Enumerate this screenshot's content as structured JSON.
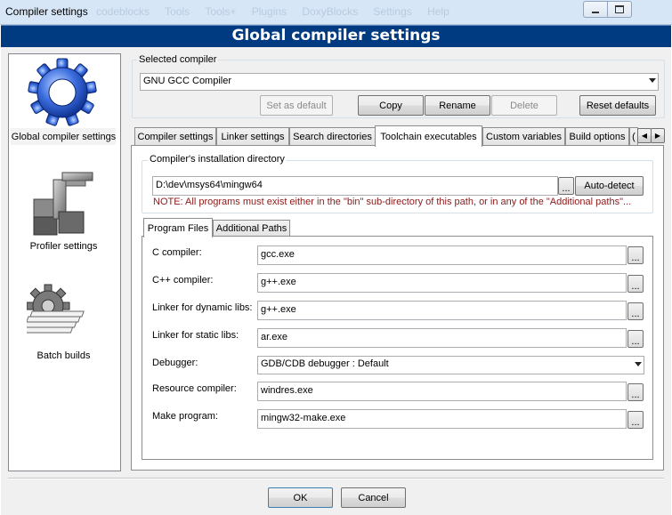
{
  "window": {
    "title": "Compiler settings",
    "ghost_menu": [
      "codeblocks",
      "Tools",
      "Tools+",
      "Plugins",
      "DoxyBlocks",
      "Settings",
      "Help"
    ]
  },
  "header": {
    "title": "Global compiler settings"
  },
  "sidebar": {
    "items": [
      {
        "label": "Global compiler settings",
        "icon": "gear-icon",
        "selected": true
      },
      {
        "label": "Profiler settings",
        "icon": "profiler-icon",
        "selected": false
      },
      {
        "label": "Batch builds",
        "icon": "batch-builds-icon",
        "selected": false
      }
    ]
  },
  "selected_compiler": {
    "group_label": "Selected compiler",
    "value": "GNU GCC Compiler",
    "buttons": {
      "set_default": "Set as default",
      "copy": "Copy",
      "rename": "Rename",
      "delete": "Delete",
      "reset_defaults": "Reset defaults"
    }
  },
  "tabs": [
    {
      "label": "Compiler settings",
      "active": false
    },
    {
      "label": "Linker settings",
      "active": false
    },
    {
      "label": "Search directories",
      "active": false
    },
    {
      "label": "Toolchain executables",
      "active": true
    },
    {
      "label": "Custom variables",
      "active": false
    },
    {
      "label": "Build options",
      "active": false
    },
    {
      "label": "(",
      "active": false
    }
  ],
  "install_dir": {
    "group_label": "Compiler's installation directory",
    "path": "D:\\dev\\msys64\\mingw64",
    "browse": "...",
    "auto_detect": "Auto-detect",
    "note": "NOTE: All programs must exist either in the \"bin\" sub-directory of this path, or in any of the \"Additional paths\"...",
    "note_color": "#8b1a1a"
  },
  "inner_tabs": [
    {
      "label": "Program Files",
      "active": true
    },
    {
      "label": "Additional Paths",
      "active": false
    }
  ],
  "programs": [
    {
      "label": "C compiler:",
      "value": "gcc.exe",
      "type": "text"
    },
    {
      "label": "C++ compiler:",
      "value": "g++.exe",
      "type": "text"
    },
    {
      "label": "Linker for dynamic libs:",
      "value": "g++.exe",
      "type": "text"
    },
    {
      "label": "Linker for static libs:",
      "value": "ar.exe",
      "type": "text"
    },
    {
      "label": "Debugger:",
      "value": "GDB/CDB debugger : Default",
      "type": "select"
    },
    {
      "label": "Resource compiler:",
      "value": "windres.exe",
      "type": "text"
    },
    {
      "label": "Make program:",
      "value": "mingw32-make.exe",
      "type": "text"
    }
  ],
  "browse_label": "...",
  "footer": {
    "ok": "OK",
    "cancel": "Cancel"
  }
}
